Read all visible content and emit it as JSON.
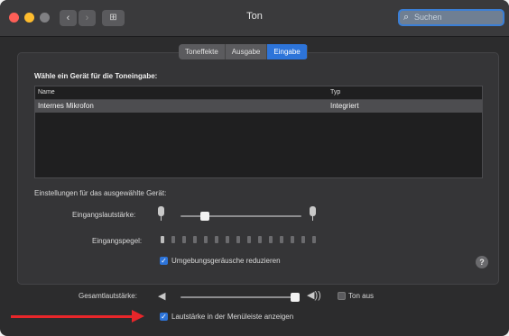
{
  "window": {
    "title": "Ton"
  },
  "search": {
    "placeholder": "Suchen"
  },
  "tabs": [
    {
      "label": "Toneffekte",
      "active": false
    },
    {
      "label": "Ausgabe",
      "active": false
    },
    {
      "label": "Eingabe",
      "active": true
    }
  ],
  "input_section": {
    "heading": "Wähle ein Gerät für die Toneingabe:",
    "columns": [
      "Name",
      "Typ"
    ],
    "rows": [
      {
        "name": "Internes Mikrofon",
        "type": "Integriert",
        "selected": true
      }
    ]
  },
  "device_settings": {
    "heading": "Einstellungen für das ausgewählte Gerät:",
    "input_volume_label": "Eingangslautstärke:",
    "input_volume_level": 0.2,
    "input_level_label": "Eingangspegel:",
    "input_level_segments_total": 15,
    "input_level_segments_lit": 1,
    "noise_reduction": {
      "label": "Umgebungsgeräusche reduzieren",
      "checked": true
    }
  },
  "output": {
    "volume_label": "Gesamtlautstärke:",
    "volume_level": 0.95,
    "mute": {
      "label": "Ton aus",
      "checked": false
    },
    "show_in_menubar": {
      "label": "Lautstärke in der Menüleiste anzeigen",
      "checked": true
    }
  },
  "colors": {
    "accent": "#2d74d9",
    "annotation_arrow": "#e8262a"
  }
}
